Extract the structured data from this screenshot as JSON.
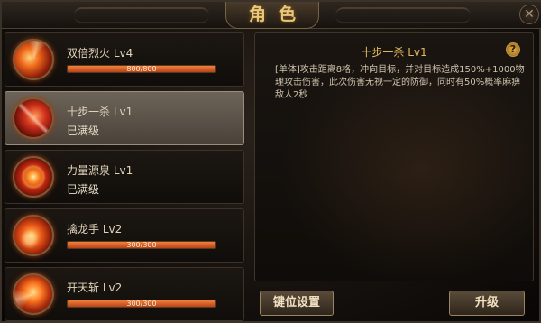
{
  "window": {
    "title": "角色",
    "close_label": "✕"
  },
  "skills": [
    {
      "name": "双倍烈火 Lv4",
      "xp_text": "800/800",
      "progress": 1.0,
      "status": ""
    },
    {
      "name": "十步一杀 Lv1",
      "xp_text": "",
      "status": "已满级"
    },
    {
      "name": "力量源泉 Lv1",
      "xp_text": "",
      "status": "已满级"
    },
    {
      "name": "擒龙手 Lv2",
      "xp_text": "300/300",
      "progress": 1.0,
      "status": ""
    },
    {
      "name": "开天斩 Lv2",
      "xp_text": "300/300",
      "progress": 1.0,
      "status": ""
    }
  ],
  "selected_index": 1,
  "detail": {
    "title": "十步一杀 Lv1",
    "help_label": "?",
    "description": "[单体]攻击距离8格，冲向目标，并对目标造成150%+1000物理攻击伤害，此次伤害无视一定的防御，同时有50%概率麻痹敌人2秒"
  },
  "buttons": {
    "keybind_label": "键位设置",
    "upgrade_label": "升级"
  },
  "colors": {
    "accent_gold": "#e3b85e",
    "xp_fill": "#f2803a",
    "selected_row": "#6d6459"
  }
}
